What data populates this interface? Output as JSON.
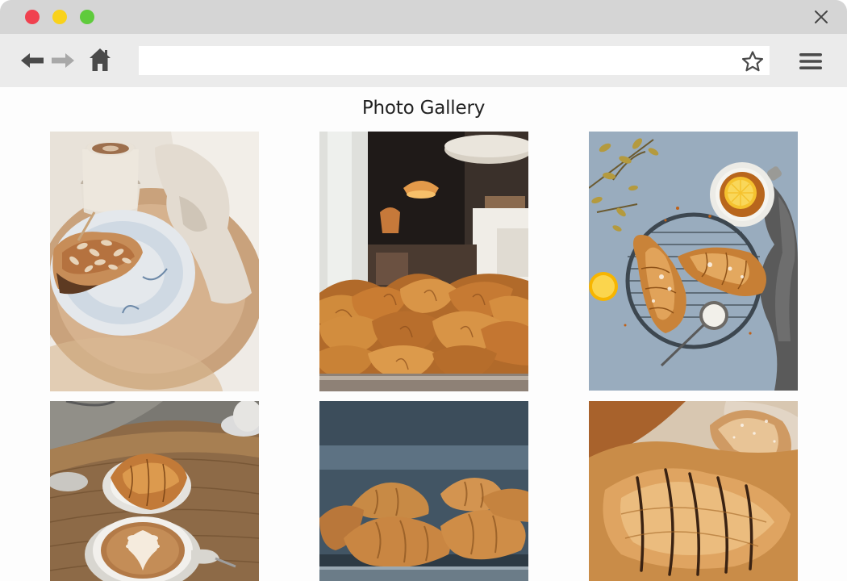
{
  "window": {
    "controls": [
      "close-dot",
      "minimize-dot",
      "maximize-dot"
    ]
  },
  "toolbar": {
    "icons": [
      "back-arrow-icon",
      "forward-arrow-icon",
      "home-icon",
      "star-icon",
      "hamburger-menu-icon"
    ],
    "url_value": ""
  },
  "page": {
    "title": "Photo Gallery"
  },
  "gallery": {
    "photos": [
      "croissant-on-plate-with-coffee",
      "bakery-croissants-display",
      "croissants-and-lemon-tea-on-rack",
      "croissant-and-latte-on-table",
      "croissants-in-tray",
      "chocolate-drizzled-croissant-closeup"
    ]
  },
  "colors": {
    "titlebar": "#d5d5d5",
    "toolbar": "#ebebeb",
    "close_dot": "#f0414f",
    "minimize_dot": "#f9d21b",
    "maximize_dot": "#5fcb3c"
  }
}
